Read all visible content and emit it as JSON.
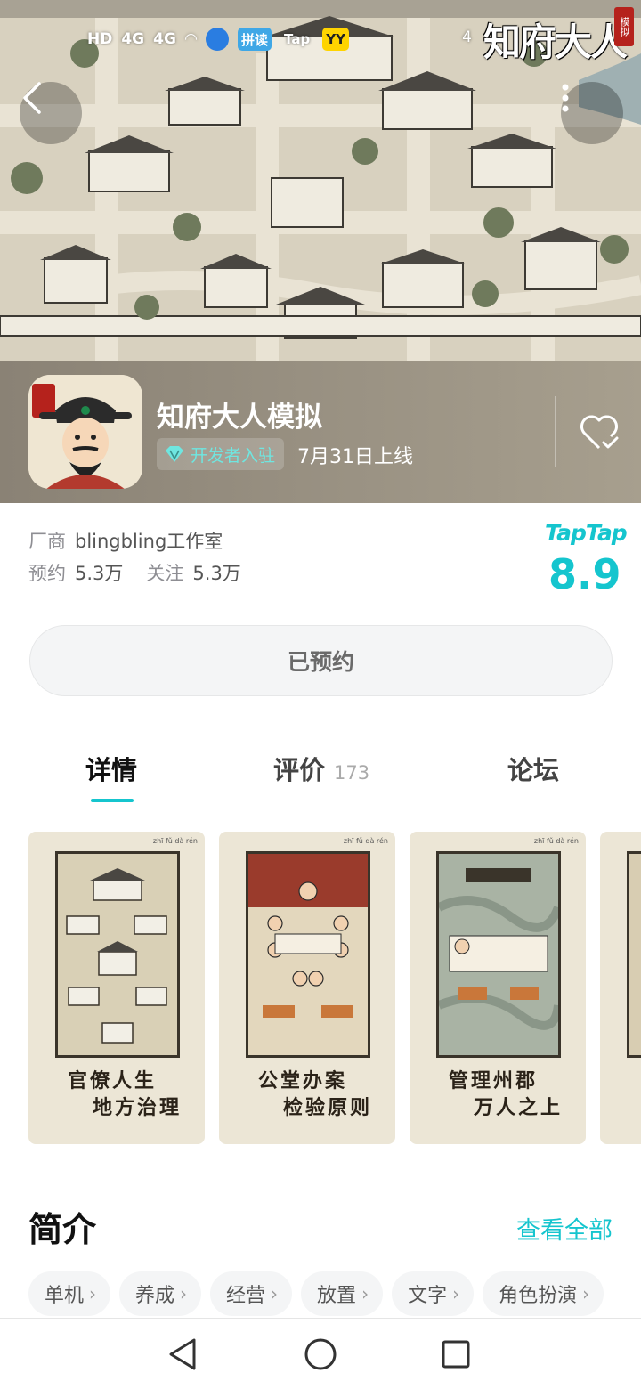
{
  "status_bar": {
    "left_labels": [
      "HD",
      "4G",
      "4G"
    ],
    "app_chips": [
      {
        "label": "",
        "kind": "blue"
      },
      {
        "label": "拼读",
        "kind": "cloud"
      },
      {
        "label": "Tap",
        "kind": "tap"
      },
      {
        "label": "YY",
        "kind": "yy"
      }
    ],
    "right_text": "4"
  },
  "hero": {
    "title_art": "知府大人",
    "seal_text": "模拟"
  },
  "app": {
    "name": "知府大人模拟",
    "developer_badge": "开发者入驻",
    "release": "7月31日上线"
  },
  "info": {
    "vendor_label": "厂商",
    "vendor_value": "blingbling工作室",
    "reserve_label": "预约",
    "reserve_value": "5.3万",
    "follow_label": "关注",
    "follow_value": "5.3万",
    "rating_source": "TapTap",
    "rating": "8.9"
  },
  "reserve_button": "已预约",
  "tabs": [
    {
      "label": "详情",
      "count": ""
    },
    {
      "label": "评价",
      "count": "173"
    },
    {
      "label": "论坛",
      "count": ""
    }
  ],
  "screenshots": [
    {
      "line1": "官僚人生",
      "line2": "地方治理",
      "top_text": "zhī fǔ dà rén"
    },
    {
      "line1": "公堂办案",
      "line2": "检验原则",
      "top_text": "zhī fǔ dà rén"
    },
    {
      "line1": "管理州郡",
      "line2": "万人之上",
      "top_text": "zhī fǔ dà rén"
    }
  ],
  "intro": {
    "title": "简介",
    "see_all": "查看全部",
    "tags": [
      "单机",
      "养成",
      "经营",
      "放置",
      "文字",
      "角色扮演"
    ]
  },
  "colors": {
    "accent": "#15c5ce",
    "band": "#9a9283"
  }
}
